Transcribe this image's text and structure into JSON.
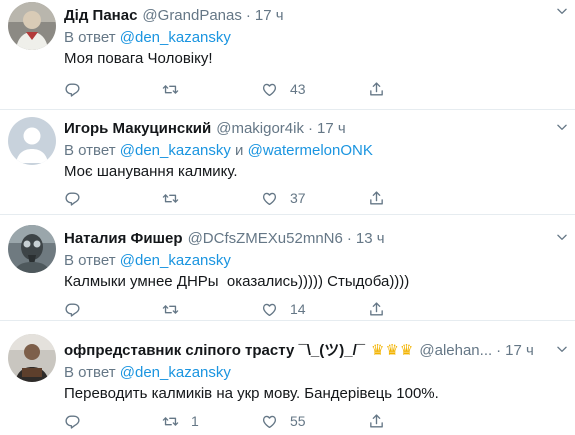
{
  "tweets": [
    {
      "name": "Дід Панас",
      "handle": "@GrandPanas",
      "dot": "·",
      "time": "17 ч",
      "reply_prefix": "В ответ",
      "reply_to_1": "@den_kazansky",
      "reply_and": "",
      "reply_to_2": "",
      "text": "Моя повага Чоловіку!",
      "counts": {
        "reply": "",
        "retweet": "",
        "like": "43"
      }
    },
    {
      "name": "Игорь Макуцинский",
      "handle": "@makigor4ik",
      "dot": "·",
      "time": "17 ч",
      "reply_prefix": "В ответ",
      "reply_to_1": "@den_kazansky",
      "reply_and": "и",
      "reply_to_2": "@watermelonONK",
      "text": "Моє шанування калмику.",
      "counts": {
        "reply": "",
        "retweet": "",
        "like": "37"
      }
    },
    {
      "name": "Наталия Фишер",
      "handle": "@DCfsZMEXu52mnN6",
      "dot": "·",
      "time": "13 ч",
      "reply_prefix": "В ответ",
      "reply_to_1": "@den_kazansky",
      "reply_and": "",
      "reply_to_2": "",
      "text": "Калмыки умнее ДНРы  оказались))))) Стыдоба))))",
      "counts": {
        "reply": "",
        "retweet": "",
        "like": "14"
      }
    },
    {
      "name": "офпредставник сліпого трасту ¯\\_(ツ)_/¯",
      "emoji": "♛♛♛",
      "handle": "@alehan...",
      "dot": "·",
      "time": "17 ч",
      "reply_prefix": "В ответ",
      "reply_to_1": "@den_kazansky",
      "reply_and": "",
      "reply_to_2": "",
      "text": "Переводить калмиків на укр мову. Бандерівець 100%.",
      "counts": {
        "reply": "",
        "retweet": "1",
        "like": "55"
      }
    }
  ],
  "colors": {
    "link": "#1b95e0",
    "muted": "#657786",
    "text": "#14171a",
    "divider": "#e6ecf0",
    "emoji": "#f2b300"
  },
  "icons": [
    "reply-icon",
    "retweet-icon",
    "like-icon",
    "share-icon",
    "caret-down-icon"
  ]
}
